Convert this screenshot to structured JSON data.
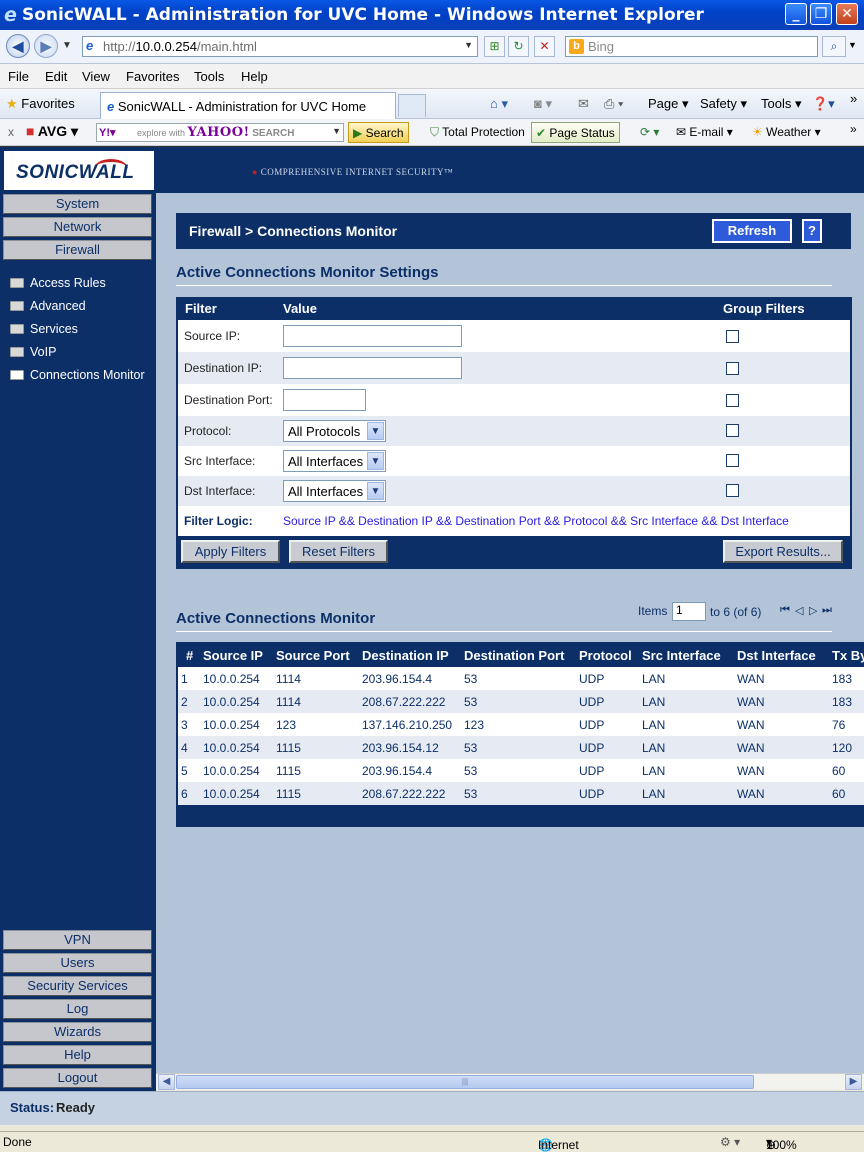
{
  "window": {
    "title": "SonicWALL - Administration for UVC Home - Windows Internet Explorer"
  },
  "address": {
    "url_prefix": "http://",
    "url_host": "10.0.0.254",
    "url_path": "/main.html",
    "search_placeholder": "Bing"
  },
  "menu": [
    "File",
    "Edit",
    "View",
    "Favorites",
    "Tools",
    "Help"
  ],
  "favbar": {
    "favorites_label": "Favorites",
    "tab_title": "SonicWALL - Administration for UVC Home",
    "page_label": "Page",
    "safety_label": "Safety",
    "tools_label": "Tools"
  },
  "avgbar": {
    "avg_label": "AVG",
    "yahoo_prefix": "explore with",
    "yahoo_brand": "YAHOO!",
    "yahoo_search": "SEARCH",
    "search_button": "Search",
    "total_protection": "Total Protection",
    "page_status": "Page Status",
    "email": "E-mail",
    "weather": "Weather"
  },
  "brand": {
    "logo": "SONICWALL",
    "tagline": "COMPREHENSIVE INTERNET SECURITY™",
    "colors": {
      "navy": "#0c2f68",
      "accent_red": "#c81e1e",
      "panel_bg": "#b3c4d8"
    }
  },
  "sidebar": {
    "top_buttons": [
      "System",
      "Network",
      "Firewall"
    ],
    "firewall_items": [
      "Access Rules",
      "Advanced",
      "Services",
      "VoIP",
      "Connections Monitor"
    ],
    "bottom_buttons": [
      "VPN",
      "Users",
      "Security Services",
      "Log",
      "Wizards",
      "Help",
      "Logout"
    ]
  },
  "page": {
    "breadcrumb": "Firewall > Connections Monitor",
    "refresh_label": "Refresh",
    "help_label": "?"
  },
  "settings": {
    "title": "Active Connections Monitor Settings",
    "col_filter": "Filter",
    "col_value": "Value",
    "col_group": "Group Filters",
    "rows": {
      "source_ip": "Source IP:",
      "dest_ip": "Destination IP:",
      "dest_port": "Destination Port:",
      "protocol": "Protocol:",
      "src_iface": "Src Interface:",
      "dst_iface": "Dst Interface:"
    },
    "protocol_value": "All Protocols",
    "src_iface_value": "All Interfaces",
    "dst_iface_value": "All Interfaces",
    "filter_logic_label": "Filter Logic:",
    "filter_logic_value": "Source IP && Destination IP && Destination Port && Protocol && Src Interface && Dst Interface",
    "apply_label": "Apply Filters",
    "reset_label": "Reset Filters",
    "export_label": "Export Results..."
  },
  "monitor": {
    "title": "Active Connections Monitor",
    "items_label": "Items",
    "items_start": "1",
    "items_range": "to 6 (of 6)",
    "headers": [
      "#",
      "Source IP",
      "Source Port",
      "Destination IP",
      "Destination Port",
      "Protocol",
      "Src Interface",
      "Dst Interface",
      "Tx By"
    ],
    "rows": [
      [
        "1",
        "10.0.0.254",
        "1114",
        "203.96.154.4",
        "53",
        "UDP",
        "LAN",
        "WAN",
        "183"
      ],
      [
        "2",
        "10.0.0.254",
        "1114",
        "208.67.222.222",
        "53",
        "UDP",
        "LAN",
        "WAN",
        "183"
      ],
      [
        "3",
        "10.0.0.254",
        "123",
        "137.146.210.250",
        "123",
        "UDP",
        "LAN",
        "WAN",
        "76"
      ],
      [
        "4",
        "10.0.0.254",
        "1115",
        "203.96.154.12",
        "53",
        "UDP",
        "LAN",
        "WAN",
        "120"
      ],
      [
        "5",
        "10.0.0.254",
        "1115",
        "203.96.154.4",
        "53",
        "UDP",
        "LAN",
        "WAN",
        "60"
      ],
      [
        "6",
        "10.0.0.254",
        "1115",
        "208.67.222.222",
        "53",
        "UDP",
        "LAN",
        "WAN",
        "60"
      ]
    ]
  },
  "status": {
    "label": "Status:",
    "value": "Ready"
  },
  "iestatus": {
    "done": "Done",
    "zone": "Internet",
    "zoom": "100%"
  }
}
